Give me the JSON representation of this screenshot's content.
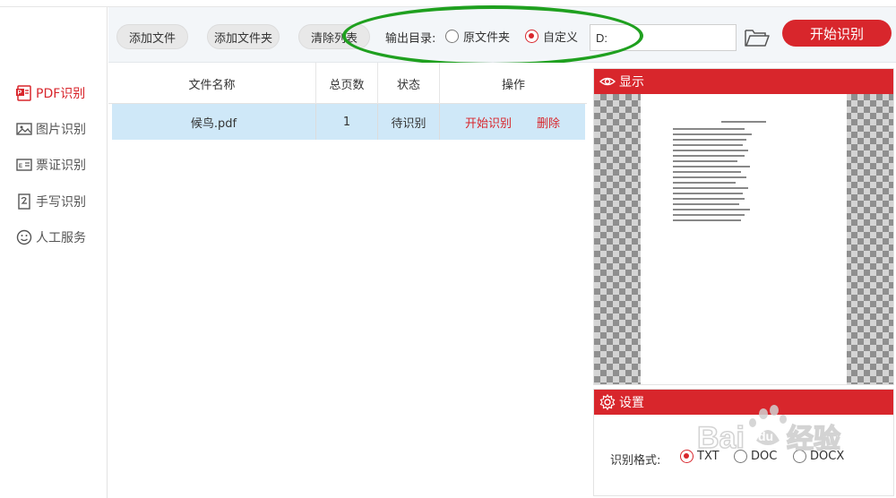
{
  "toolbar": {
    "add_file": "添加文件",
    "add_folder": "添加文件夹",
    "clear_list": "清除列表",
    "output_dir_label": "输出目录:",
    "radio_original": "原文件夹",
    "radio_custom": "自定义",
    "output_path": "D:",
    "start_button": "开始识别"
  },
  "sidebar": {
    "items": [
      {
        "label": "PDF识别",
        "icon": "pdf-icon",
        "active": true
      },
      {
        "label": "图片识别",
        "icon": "image-icon",
        "active": false
      },
      {
        "label": "票证识别",
        "icon": "ticket-icon",
        "active": false
      },
      {
        "label": "手写识别",
        "icon": "handwriting-icon",
        "active": false
      },
      {
        "label": "人工服务",
        "icon": "smiley-icon",
        "active": false
      }
    ]
  },
  "table": {
    "headers": [
      "文件名称",
      "总页数",
      "状态",
      "操作"
    ],
    "rows": [
      {
        "name": "候鸟.pdf",
        "pages": "1",
        "status": "待识别",
        "action_start": "开始识别",
        "action_delete": "删除"
      }
    ]
  },
  "preview": {
    "title": "显示"
  },
  "settings": {
    "title": "设置",
    "format_label": "识别格式:",
    "formats": [
      "TXT",
      "DOC",
      "DOCX"
    ],
    "selected_format": "TXT"
  },
  "watermark": {
    "text": "Baidu经验"
  },
  "colors": {
    "accent": "#d8262c",
    "row_selected": "#cfe8f8",
    "highlight": "#1fa01f"
  }
}
